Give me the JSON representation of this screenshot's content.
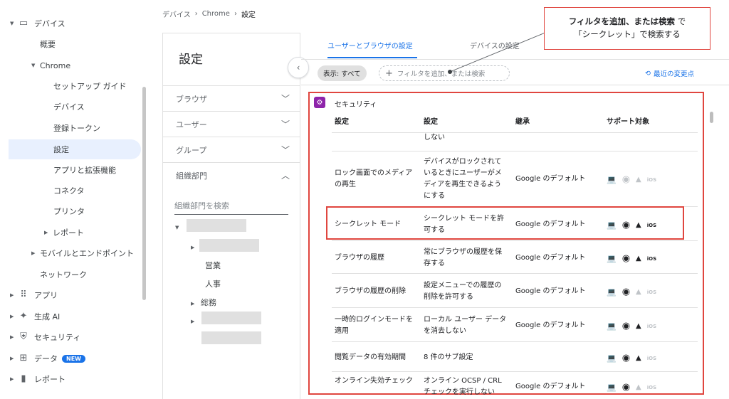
{
  "nav": {
    "devices": "デバイス",
    "overview": "概要",
    "chrome": "Chrome",
    "setup_guide": "セットアップ ガイド",
    "chrome_devices": "デバイス",
    "enroll_token": "登録トークン",
    "settings": "設定",
    "apps": "アプリと拡張機能",
    "connectors": "コネクタ",
    "printers": "プリンタ",
    "reports": "レポート",
    "mobile": "モバイルとエンドポイント",
    "network": "ネットワーク",
    "apps_top": "アプリ",
    "gen_ai": "生成 AI",
    "security": "セキュリティ",
    "data": "データ",
    "data_badge": "NEW",
    "reports_top": "レポート"
  },
  "breadcrumb": [
    "デバイス",
    "Chrome",
    "設定"
  ],
  "settings_col": {
    "title": "設定",
    "sections": [
      "ブラウザ",
      "ユーザー",
      "グループ",
      "組織部門"
    ],
    "org_search_placeholder": "組織部門を検索",
    "org_units": [
      "営業",
      "人事",
      "総務"
    ]
  },
  "tabs": [
    "ユーザーとブラウザの設定",
    "デバイスの設定"
  ],
  "filter": {
    "chip": "表示: すべて",
    "placeholder": "フィルタを追加、または検索",
    "recent": "最近の変更点"
  },
  "panel": {
    "title": "セキュリティ",
    "headers": [
      "設定",
      "設定",
      "継承",
      "サポート対象"
    ],
    "partial_row": "しない",
    "rows": [
      {
        "name": "ロック画面でのメディアの再生",
        "value": "デバイスがロックされているときにユーザーがメディアを再生できるようにする",
        "inherit": "Google のデフォルト",
        "devices": [
          1,
          0,
          0,
          0
        ]
      },
      {
        "name": "シークレット モード",
        "value": "シークレット モードを許可する",
        "inherit": "Google のデフォルト",
        "devices": [
          1,
          1,
          1,
          1
        ]
      },
      {
        "name": "ブラウザの履歴",
        "value": "常にブラウザの履歴を保存する",
        "inherit": "Google のデフォルト",
        "devices": [
          1,
          1,
          1,
          1
        ]
      },
      {
        "name": "ブラウザの履歴の削除",
        "value": "設定メニューでの履歴の削除を許可する",
        "inherit": "Google のデフォルト",
        "devices": [
          1,
          1,
          0,
          0
        ]
      },
      {
        "name": "一時的ログインモードを適用",
        "value": "ローカル ユーザー データを消去しない",
        "inherit": "Google のデフォルト",
        "devices": [
          0,
          1,
          1,
          0
        ]
      },
      {
        "name": "閲覧データの有効期間",
        "value": "8 件のサブ設定",
        "inherit": "",
        "devices": [
          1,
          1,
          1,
          0
        ]
      },
      {
        "name": "オンライン失効チェック",
        "value": "オンライン OCSP / CRL チェックを実行しない",
        "inherit": "Google のデフォルト",
        "devices": [
          1,
          1,
          0,
          0
        ]
      }
    ]
  },
  "callout": {
    "bold": "フィルタを追加、または検索",
    "rest1": " で",
    "line2": "「シークレット」で検索する"
  },
  "ios_label": "iOS"
}
